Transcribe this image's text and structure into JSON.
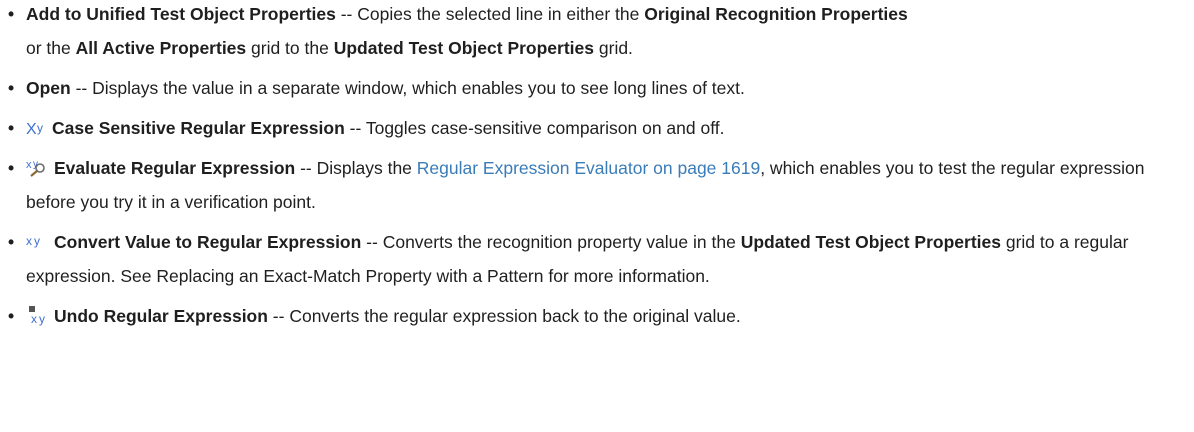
{
  "items": [
    {
      "icon": null,
      "parts": [
        {
          "t": "b",
          "v": "Add to Unified Test Object Properties"
        },
        {
          "t": "n",
          "v": " -- Copies the selected line in either the "
        },
        {
          "t": "b",
          "v": "Original Recognition Properties"
        },
        {
          "t": "n",
          "v": " or the "
        },
        {
          "t": "b",
          "v": "All Active Properties"
        },
        {
          "t": "n",
          "v": " grid to the "
        },
        {
          "t": "b",
          "v": "Updated Test Object Properties"
        },
        {
          "t": "n",
          "v": " grid."
        }
      ]
    },
    {
      "icon": null,
      "parts": [
        {
          "t": "b",
          "v": "Open"
        },
        {
          "t": "n",
          "v": " -- Displays the value in a separate window, which enables you to see long lines of text."
        }
      ]
    },
    {
      "icon": "case-sensitive-regex-icon",
      "parts": [
        {
          "t": "b",
          "v": "Case Sensitive Regular Expression"
        },
        {
          "t": "n",
          "v": " -- Toggles case-sensitive comparison on and off."
        }
      ]
    },
    {
      "icon": "evaluate-regex-icon",
      "parts": [
        {
          "t": "b",
          "v": "Evaluate Regular Expression"
        },
        {
          "t": "n",
          "v": " -- Displays the "
        },
        {
          "t": "l",
          "v": "Regular Expression Evaluator on page 1619"
        },
        {
          "t": "n",
          "v": ", which enables you to test the regular expression before you try it in a verification point."
        }
      ]
    },
    {
      "icon": "convert-to-regex-icon",
      "parts": [
        {
          "t": "b",
          "v": "Convert Value to Regular Expression"
        },
        {
          "t": "n",
          "v": " -- Converts the recognition property value in the "
        },
        {
          "t": "b",
          "v": "Updated Test Object Properties"
        },
        {
          "t": "n",
          "v": " grid to a regular expression. See Replacing an Exact-Match Property with a Pattern for more information."
        }
      ]
    },
    {
      "icon": "undo-regex-icon",
      "parts": [
        {
          "t": "b",
          "v": "Undo Regular Expression"
        },
        {
          "t": "n",
          "v": " -- Converts the regular expression back to the original value."
        }
      ]
    }
  ],
  "bullet_char": "•",
  "colors": {
    "text": "#1f1f1f",
    "link": "#3a7cb8",
    "icon_blue": "#3c6fd0"
  }
}
